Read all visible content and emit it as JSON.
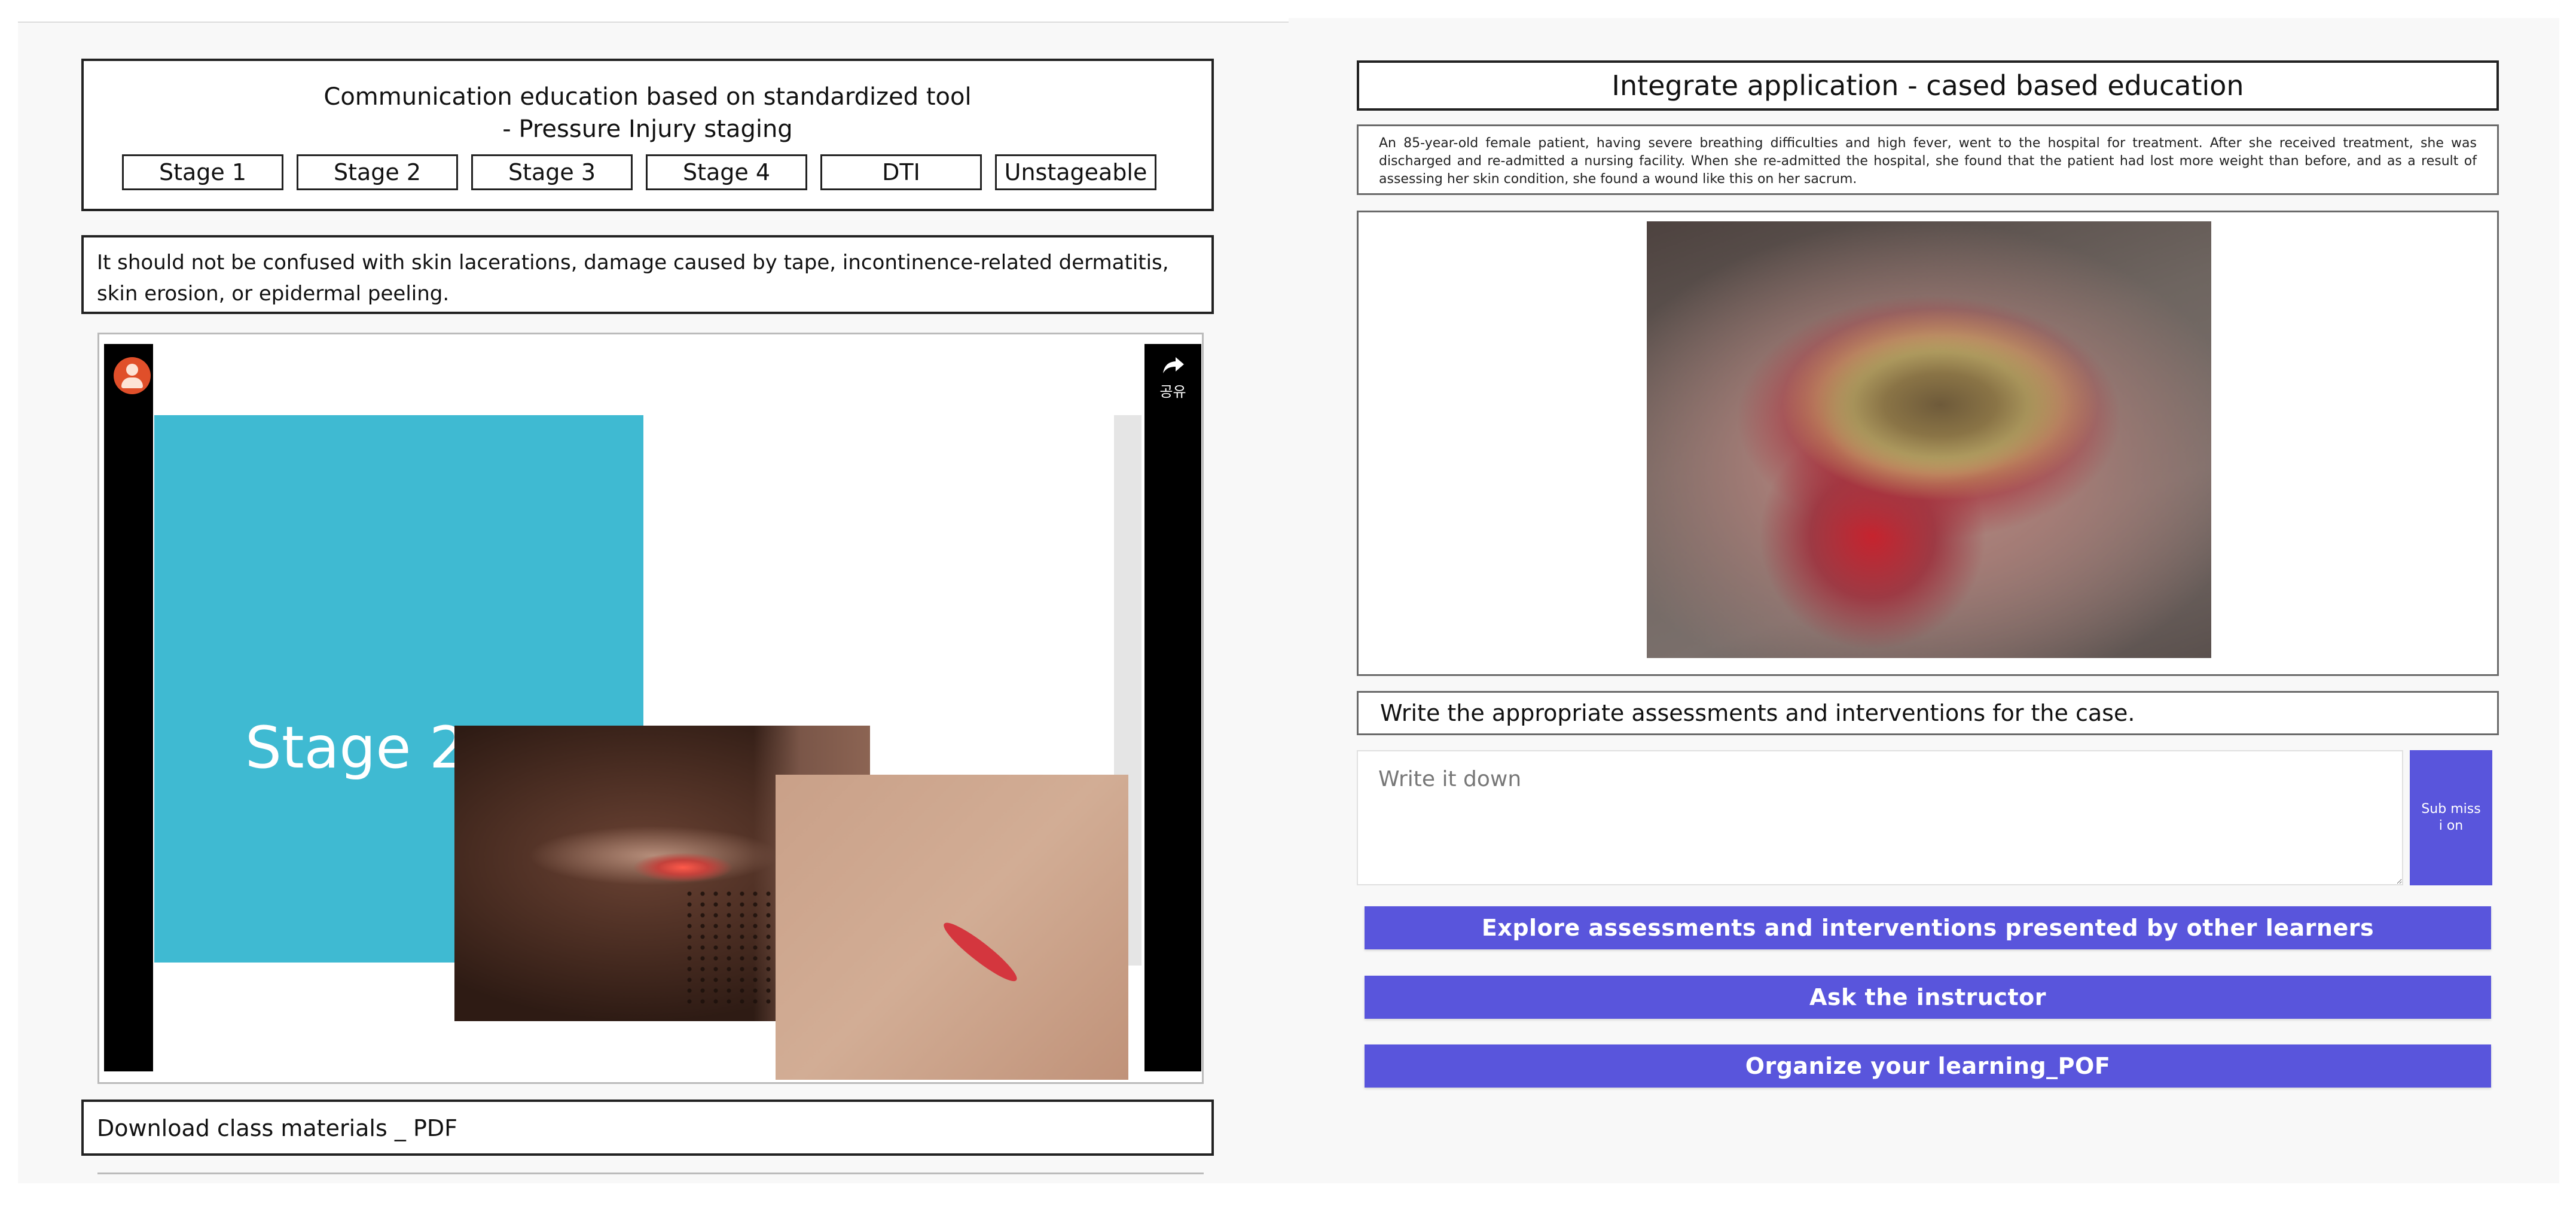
{
  "left": {
    "comm_title_line1": "Communication education based on standardized tool",
    "comm_title_line2": "- Pressure Injury staging",
    "stage_buttons": [
      "Stage 1",
      "Stage 2",
      "Stage 3",
      "Stage 4",
      "DTI",
      "Unstageable"
    ],
    "note": "It should not be confused with skin lacerations, damage caused by tape, incontinence-related dermatitis, skin erosion, or epidermal peeling.",
    "video": {
      "slide_title": "Stage 2",
      "share_label": "공유",
      "share_icon": "share-arrow-icon",
      "avatar_icon": "user-avatar-icon"
    },
    "download_label": "Download class materials _ PDF"
  },
  "right": {
    "title": "Integrate application - cased based education",
    "case_text": "An 85-year-old female patient, having severe breathing difficulties and high fever, went to the hospital for treatment. After she received treatment, she was discharged and re-admitted a nursing facility. When she re-admitted the hospital, she found that the patient had lost more weight than before, and as a result of assessing her skin condition, she found a wound like this on her sacrum.",
    "instruction": "Write the appropriate assessments and interventions for the case.",
    "answer_placeholder": "Write it down",
    "answer_value": "",
    "submit_label": "Sub missi on",
    "buttons": [
      "Explore assessments and interventions presented by other learners",
      "Ask the instructor",
      "Organize your learning_POF"
    ]
  },
  "colors": {
    "accent": "#5955dc",
    "slide_teal": "#3fbad2",
    "border": "#222222"
  }
}
